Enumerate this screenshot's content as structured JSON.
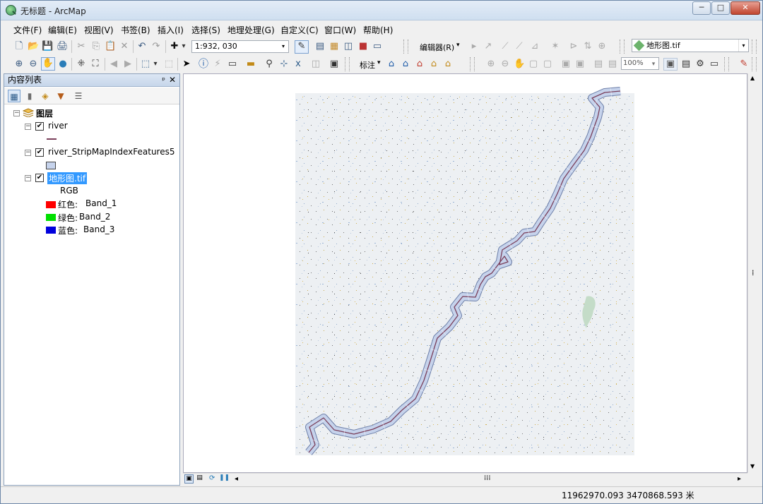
{
  "window": {
    "title": "无标题 - ArcMap",
    "minimize": "─",
    "maximize": "□",
    "close": "✕"
  },
  "menu": [
    "文件(F)",
    "编辑(E)",
    "视图(V)",
    "书签(B)",
    "插入(I)",
    "选择(S)",
    "地理处理(G)",
    "自定义(C)",
    "窗口(W)",
    "帮助(H)"
  ],
  "standard_toolbar": {
    "scale": "1:932, 030",
    "editor_label": "编辑器(R)",
    "editor_arrow": "▾",
    "current_layer": "地形图.tif"
  },
  "tools_toolbar": {
    "label_tool": "标注",
    "label_arrow": "▾",
    "zoom_percent": "100%"
  },
  "toc": {
    "title": "内容列表",
    "pin": "ᵖ",
    "close": "✕",
    "root": "图层",
    "layers": [
      {
        "name": "river",
        "checked": "✔"
      },
      {
        "name": "river_StripMapIndexFeatures5",
        "checked": "✔"
      },
      {
        "name": "地形图.tif",
        "checked": "✔"
      }
    ],
    "raster_legend": {
      "mode": "RGB",
      "bands": [
        {
          "label": "红色:",
          "value": "Band_1",
          "color": "#ff0000"
        },
        {
          "label": "绿色:",
          "value": "Band_2",
          "color": "#00e000"
        },
        {
          "label": "蓝色:",
          "value": "Band_3",
          "color": "#0000dd"
        }
      ]
    }
  },
  "icons": {
    "new": "🗋",
    "open": "📂",
    "save": "💾",
    "print": "🖨",
    "cut": "✂",
    "copy": "⎘",
    "paste": "📋",
    "delete": "✕",
    "undo": "↶",
    "redo": "↷",
    "add_data": "✚",
    "zoom_in": "⊕",
    "zoom_out": "⊖",
    "pan": "✋",
    "globe": "●",
    "full_extent": "⛶",
    "back": "◀",
    "forward": "▶",
    "select": "➤",
    "identify": "ⓘ",
    "find": "🔍",
    "dropdown": "▾",
    "expander_open": "⊟",
    "list_view": "☰"
  },
  "map": {
    "raster_bg": "#edf0f3",
    "river_color": "#7a3f5a",
    "strip_fill": "#c6d3ec",
    "strip_stroke": "#6d7fa8"
  },
  "status": {
    "coordinates": "11962970.093  3470868.593 米"
  },
  "scroll": {
    "up": "▲",
    "down": "▼",
    "left": "◂",
    "right": "▸",
    "grip": "⁞",
    "hgrip": "⁞⁞⁞"
  }
}
